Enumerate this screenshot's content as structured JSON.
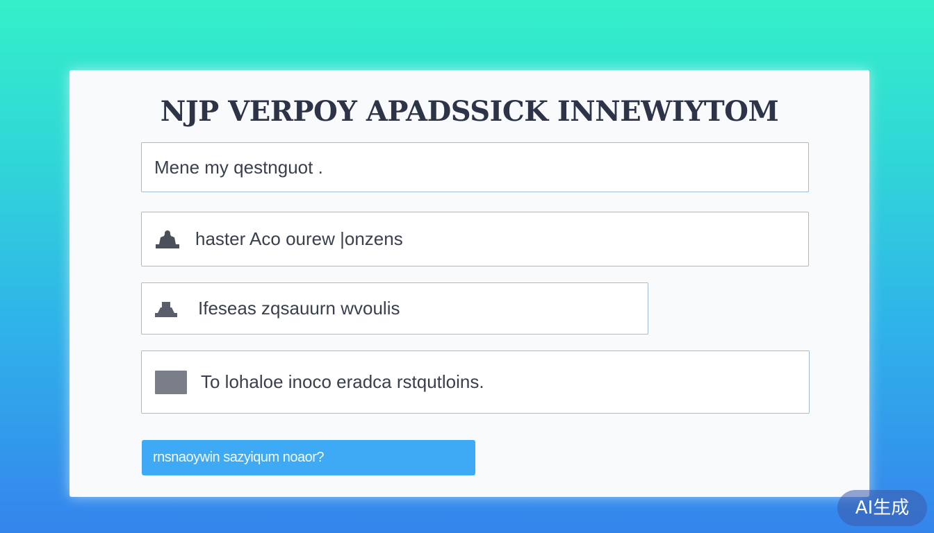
{
  "form": {
    "title": "NJP VERPOY APADSSICK INNEWIYTOM",
    "fields": [
      {
        "value": "Mene my qestnguot ."
      },
      {
        "value": "haster Aco ourew |onzens",
        "icon": "person-icon"
      },
      {
        "value": "Ifeseas zqsauurn wvoulis",
        "icon": "hat-icon"
      },
      {
        "value": "To lohaloe inoco eradca rstqutloins.",
        "icon": "square-icon"
      }
    ],
    "submit_label": "rnsnaoywin sazyiqum noaor?"
  },
  "watermark": {
    "label": "AI生成"
  },
  "colors": {
    "background_top": "#34f0c8",
    "background_bottom": "#3584ec",
    "button": "#3eaaf6",
    "title": "#2d3448"
  }
}
